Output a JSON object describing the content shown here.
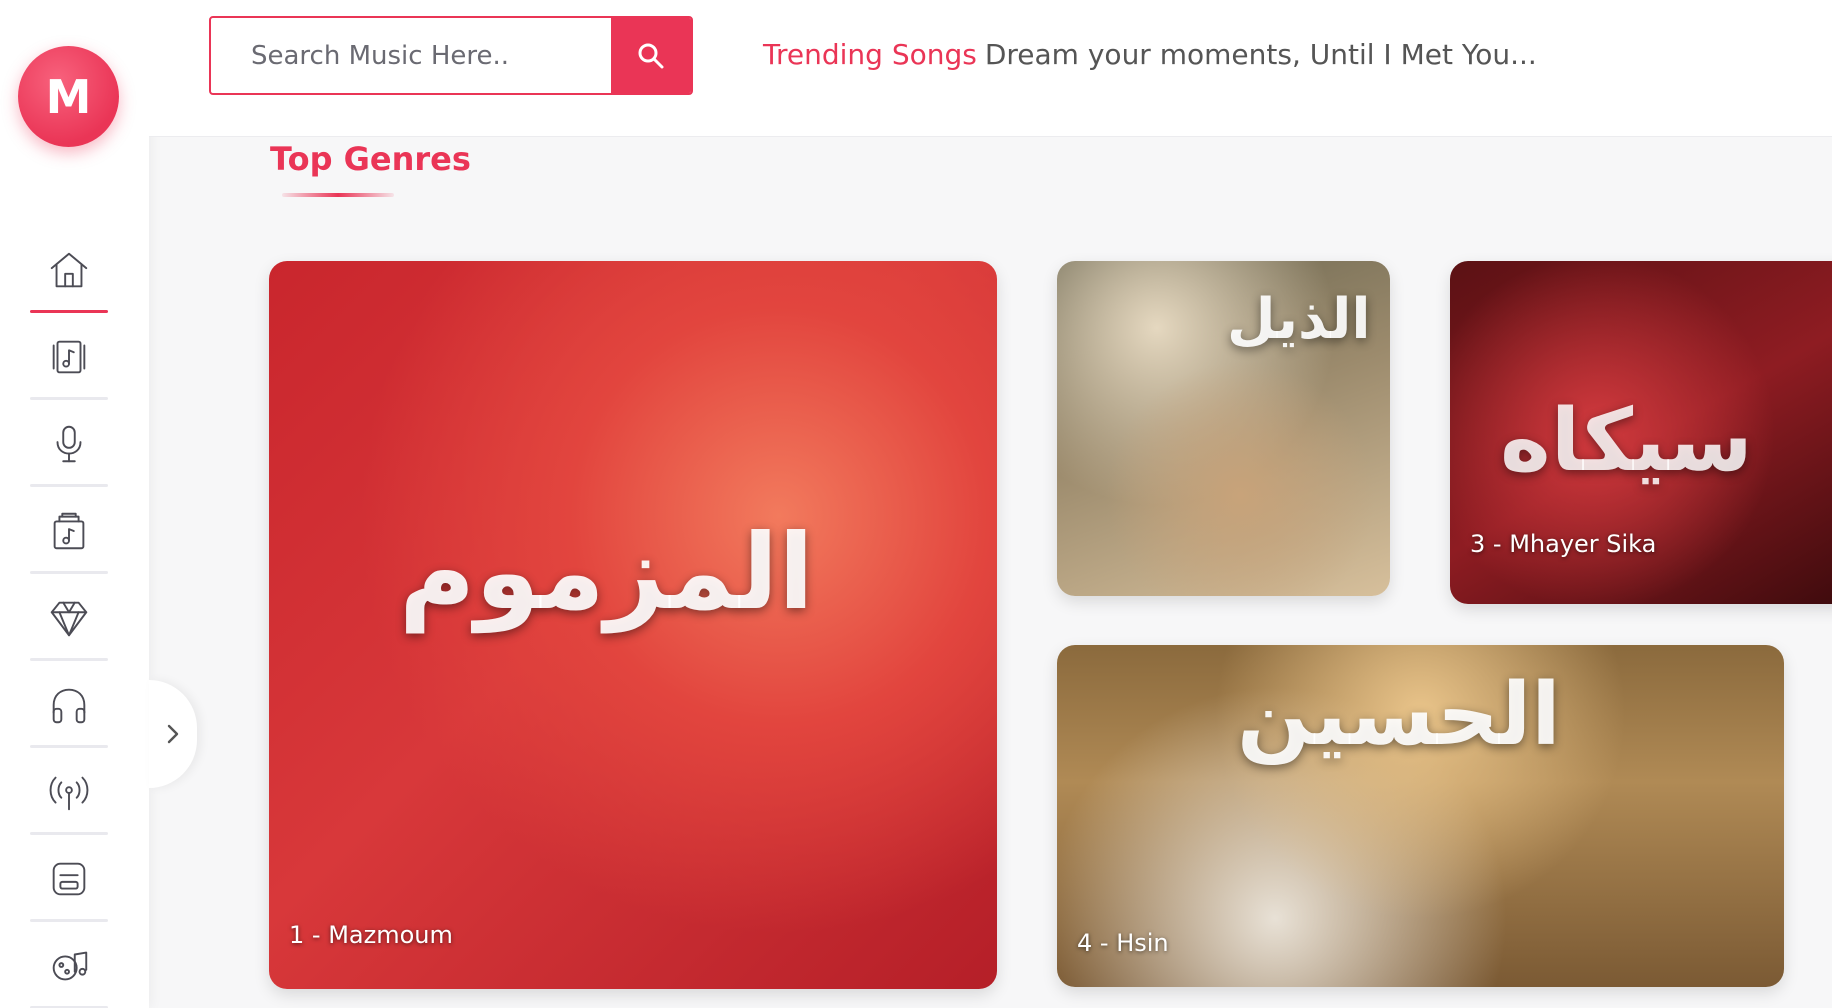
{
  "brand": {
    "logo_letter": "M"
  },
  "search": {
    "placeholder": "Search Music Here.."
  },
  "header": {
    "trending_label": "Trending Songs",
    "trending_text": "Dream your moments, Until I Met You..."
  },
  "sidebar": {
    "items": [
      {
        "name": "home",
        "icon": "home-icon",
        "active": true
      },
      {
        "name": "albums",
        "icon": "album-icon",
        "active": false
      },
      {
        "name": "artists",
        "icon": "microphone-icon",
        "active": false
      },
      {
        "name": "playlists",
        "icon": "music-box-icon",
        "active": false
      },
      {
        "name": "premium",
        "icon": "diamond-icon",
        "active": false
      },
      {
        "name": "listen",
        "icon": "headphones-icon",
        "active": false
      },
      {
        "name": "radio",
        "icon": "broadcast-icon",
        "active": false
      },
      {
        "name": "devices",
        "icon": "device-icon",
        "active": false
      },
      {
        "name": "music-library",
        "icon": "music-library-icon",
        "active": false
      }
    ]
  },
  "genres": {
    "title": "Top Genres",
    "cards": [
      {
        "caption": "1 - Mazmoum",
        "art_text": "المزموم"
      },
      {
        "caption": "",
        "art_text": "الذيل"
      },
      {
        "caption": "3 - Mhayer Sika",
        "art_text": "سيكاه"
      },
      {
        "caption": "4 - Hsin",
        "art_text": "الحسين"
      }
    ]
  },
  "colors": {
    "accent": "#ea3556",
    "background": "#f7f7f8",
    "sidebar": "#ffffff"
  }
}
